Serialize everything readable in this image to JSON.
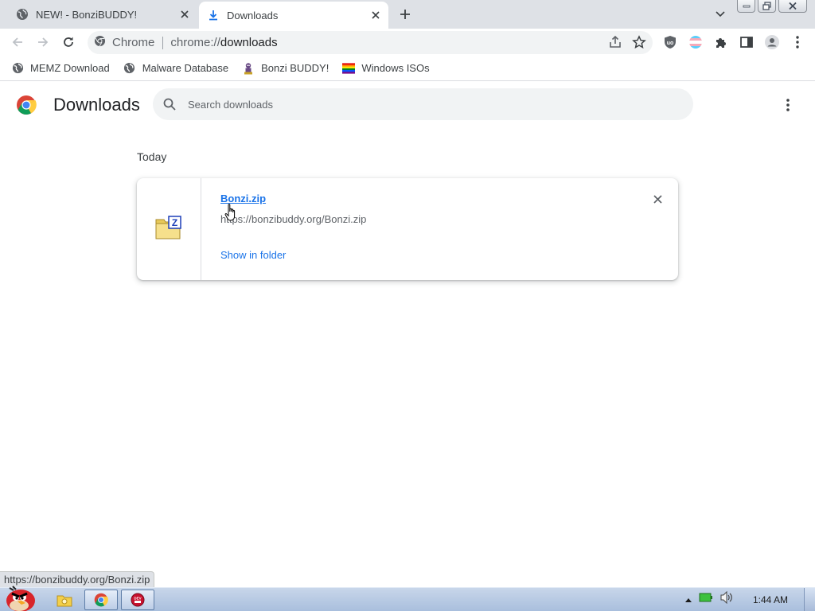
{
  "tabs": [
    {
      "label": "NEW! - BonziBUDDY!",
      "icon": "globe-icon",
      "active": false
    },
    {
      "label": "Downloads",
      "icon": "download-icon",
      "active": true
    }
  ],
  "omnibox": {
    "site_label": "Chrome",
    "url_scheme": "chrome://",
    "url_host": "downloads"
  },
  "bookmarks": [
    {
      "label": "MEMZ Download",
      "icon": "globe-icon"
    },
    {
      "label": "Malware Database",
      "icon": "globe-icon"
    },
    {
      "label": "Bonzi BUDDY!",
      "icon": "bonzi-icon"
    },
    {
      "label": "Windows ISOs",
      "icon": "rainbow-flag-icon"
    }
  ],
  "downloads_page": {
    "title": "Downloads",
    "search_placeholder": "Search downloads",
    "section_label": "Today",
    "items": [
      {
        "file_name": "Bonzi.zip",
        "url": "https://bonzibuddy.org/Bonzi.zip",
        "action_label": "Show in folder",
        "icon": "zip-folder-icon"
      }
    ]
  },
  "status_bubble": "https://bonzibuddy.org/Bonzi.zip",
  "taskbar": {
    "clock": "1:44 AM",
    "pinned": [
      "explorer-icon",
      "chrome-icon",
      "dev-app-icon"
    ]
  },
  "colors": {
    "accent_blue": "#1a73e8",
    "tabstrip": "#dee1e6",
    "taskbar": "#b7c9e2"
  }
}
